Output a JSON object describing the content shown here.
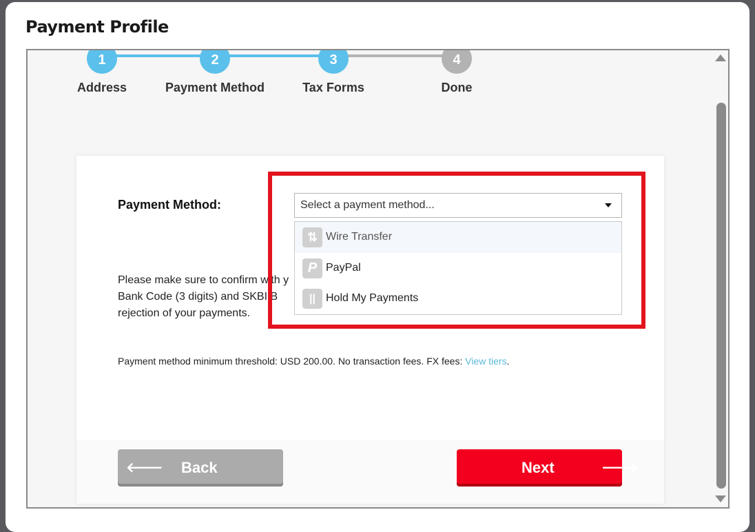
{
  "modal": {
    "title": "Payment Profile"
  },
  "stepper": {
    "steps": [
      {
        "number": "1",
        "label": "Address",
        "status": "completed"
      },
      {
        "number": "2",
        "label": "Payment Method",
        "status": "completed"
      },
      {
        "number": "3",
        "label": "Tax Forms",
        "status": "completed"
      },
      {
        "number": "4",
        "label": "Done",
        "status": "pending"
      }
    ],
    "active_color": "#5bc0eb",
    "inactive_color": "#b3b3b3"
  },
  "form": {
    "payment_method_label": "Payment Method:",
    "select_placeholder": "Select a payment method...",
    "notice_lines": [
      "Please make sure to confirm with y",
      "Bank Code (3 digits) and SK",
      "rejection of your payments."
    ],
    "notice_obscured_fragment": "BI B",
    "threshold_text": "Payment method minimum threshold: USD 200.00. No transaction fees. FX fees: ",
    "view_tiers_link": "View tiers",
    "threshold_suffix": "."
  },
  "dropdown": {
    "options": [
      {
        "label": "Wire Transfer",
        "icon": "wire-transfer-icon",
        "glyph": "⇅",
        "highlighted": true
      },
      {
        "label": "PayPal",
        "icon": "paypal-icon",
        "glyph": "P",
        "highlighted": false
      },
      {
        "label": "Hold My Payments",
        "icon": "hold-payments-icon",
        "glyph": "||",
        "highlighted": false
      }
    ]
  },
  "buttons": {
    "back_label": "Back",
    "next_label": "Next",
    "back_arrow": "🡐",
    "next_arrow": "🡒"
  },
  "colors": {
    "brand_red": "#f2001e",
    "highlight_box": "#e2151f",
    "link": "#5bb8d8"
  }
}
